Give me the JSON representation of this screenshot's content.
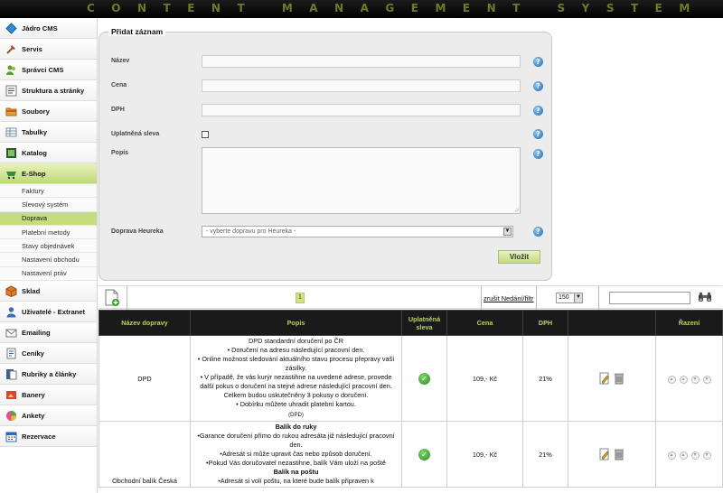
{
  "header": {
    "title": "CONTENT MANAGEMENT SYSTEM"
  },
  "sidebar": {
    "items_top": [
      {
        "label": "Jádro CMS",
        "icon": "diamond-icon"
      },
      {
        "label": "Servis",
        "icon": "tools-icon"
      },
      {
        "label": "Správci CMS",
        "icon": "users-icon"
      },
      {
        "label": "Struktura a stránky",
        "icon": "structure-icon"
      },
      {
        "label": "Soubory",
        "icon": "folder-icon"
      },
      {
        "label": "Tabulky",
        "icon": "table-icon"
      },
      {
        "label": "Katalog",
        "icon": "catalog-icon"
      },
      {
        "label": "E-Shop",
        "icon": "cart-icon"
      }
    ],
    "eshop_sub": [
      {
        "label": "Faktury"
      },
      {
        "label": "Slevový systém"
      },
      {
        "label": "Doprava"
      },
      {
        "label": "Platební metody"
      },
      {
        "label": "Stavy objednávek"
      },
      {
        "label": "Nastavení obchodu"
      },
      {
        "label": "Nastavení práv"
      }
    ],
    "items_bottom": [
      {
        "label": "Sklad",
        "icon": "box-icon"
      },
      {
        "label": "Uživatelé - Extranet",
        "icon": "user-icon"
      },
      {
        "label": "Emailing",
        "icon": "mail-icon"
      },
      {
        "label": "Ceníky",
        "icon": "pricelist-icon"
      },
      {
        "label": "Rubriky a články",
        "icon": "articles-icon"
      },
      {
        "label": "Banery",
        "icon": "banner-icon"
      },
      {
        "label": "Ankety",
        "icon": "poll-icon"
      },
      {
        "label": "Rezervace",
        "icon": "calendar-icon"
      }
    ],
    "active_item": "E-Shop",
    "active_sub": "Doprava"
  },
  "form": {
    "legend": "Přidat záznam",
    "fields": {
      "name": {
        "label": "Název",
        "value": ""
      },
      "price": {
        "label": "Cena",
        "value": ""
      },
      "vat": {
        "label": "DPH",
        "value": ""
      },
      "discount": {
        "label": "Uplatněná sleva",
        "checked": false
      },
      "description": {
        "label": "Popis",
        "value": ""
      },
      "heureka": {
        "label": "Doprava Heureka",
        "selected": "- vyberte dopravu pro Heureka -"
      }
    },
    "submit_label": "Vložit"
  },
  "toolbar": {
    "page": "1",
    "filter_link": "zrušit Nedání/filtr",
    "per_page": "150",
    "search_value": ""
  },
  "table": {
    "headers": [
      "Název dopravy",
      "Popis",
      "Uplatněná sleva",
      "Cena",
      "DPH",
      "",
      "Řazení"
    ],
    "rows": [
      {
        "name": "DPD",
        "description": [
          {
            "text": "DPD standardní doručení po ČR",
            "bold": false
          },
          {
            "text": "• Doručení na adresu následující pracovní den.",
            "bold": false
          },
          {
            "text": "• Online možnost sledování aktuálního stavu procesu přepravy vaší zásilky.",
            "bold": false
          },
          {
            "text": "• V případě, že vás kurýr nezastihne na uvedené adrese, provede další pokus o doručení na stejné adrese následující pracovní den. Celkem budou uskutečněny 3 pokusy o doručení.",
            "bold": false
          },
          {
            "text": "• Dobírku můžete uhradit platební kartou.",
            "bold": false
          },
          {
            "text": "(DPD)",
            "bold": false
          }
        ],
        "discount": true,
        "price": "109,- Kč",
        "vat": "21%"
      },
      {
        "name": "Obchodní balík Česká",
        "description": [
          {
            "text": "Balík do ruky",
            "bold": true
          },
          {
            "text": "•Garance doručení přímo do rukou adresáta již následující pracovní den.",
            "bold": false
          },
          {
            "text": "•Adresát si může upravit čas nebo způsob doručení.",
            "bold": false
          },
          {
            "text": "•Pokud Vás doručovatel nezastihne, balík Vám uloží na poště",
            "bold": false
          },
          {
            "text": "Balík na poštu",
            "bold": true
          },
          {
            "text": "•Adresát si volí poštu, na které bude balík připraven k",
            "bold": false
          }
        ],
        "discount": true,
        "price": "109,- Kč",
        "vat": "21%"
      }
    ]
  },
  "colors": {
    "accent": "#b8d44d",
    "active_bg": "#c5dd7c",
    "header_bg": "#1a1a1a"
  }
}
